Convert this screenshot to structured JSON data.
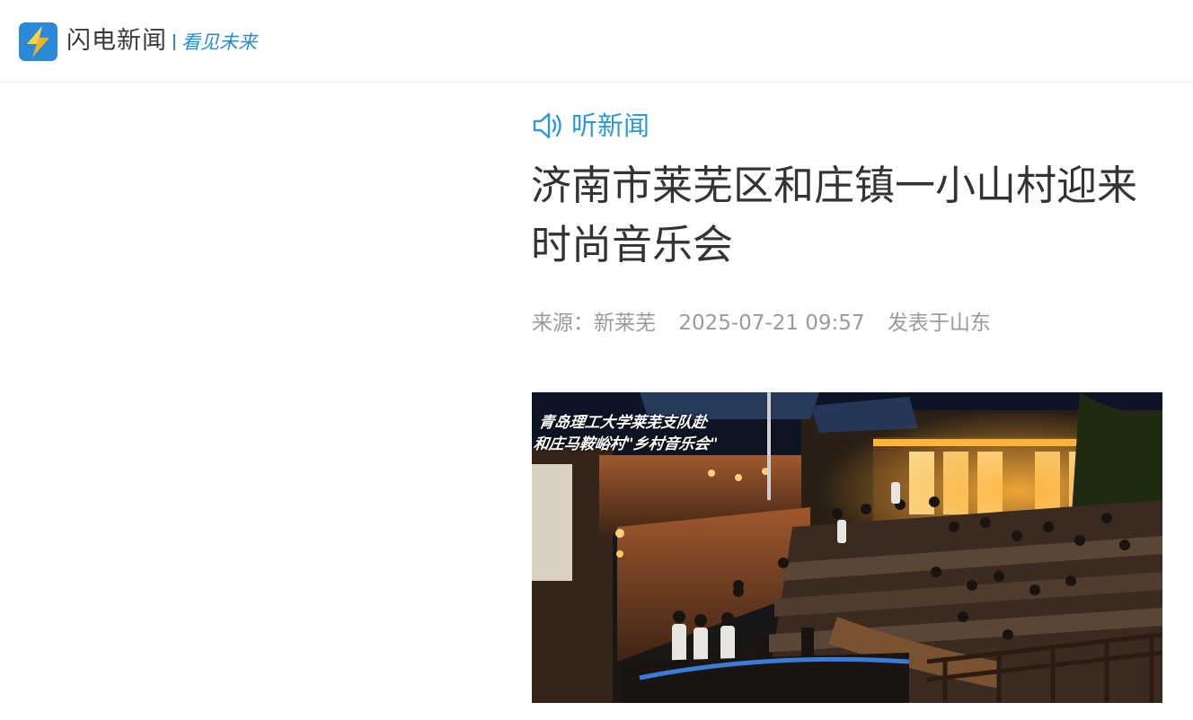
{
  "header": {
    "brand_name": "闪电新闻",
    "slogan": "看见未来"
  },
  "listen": {
    "label": "听新闻",
    "icon": "speaker-icon"
  },
  "article": {
    "title": "济南市莱芜区和庄镇一小山村迎来时尚音乐会",
    "source": "来源：新莱芜",
    "datetime": "2025-07-21 09:57",
    "location": "发表于山东"
  },
  "photo": {
    "caption_line1": "青岛理工大学莱芜支队赴",
    "caption_line2": "和庄马鞍峪村\"乡村音乐会\""
  },
  "colors": {
    "brand_blue": "#2a8ad8",
    "listen_blue": "#2d9ad6",
    "title": "#333333",
    "meta": "#9a9a9a"
  }
}
